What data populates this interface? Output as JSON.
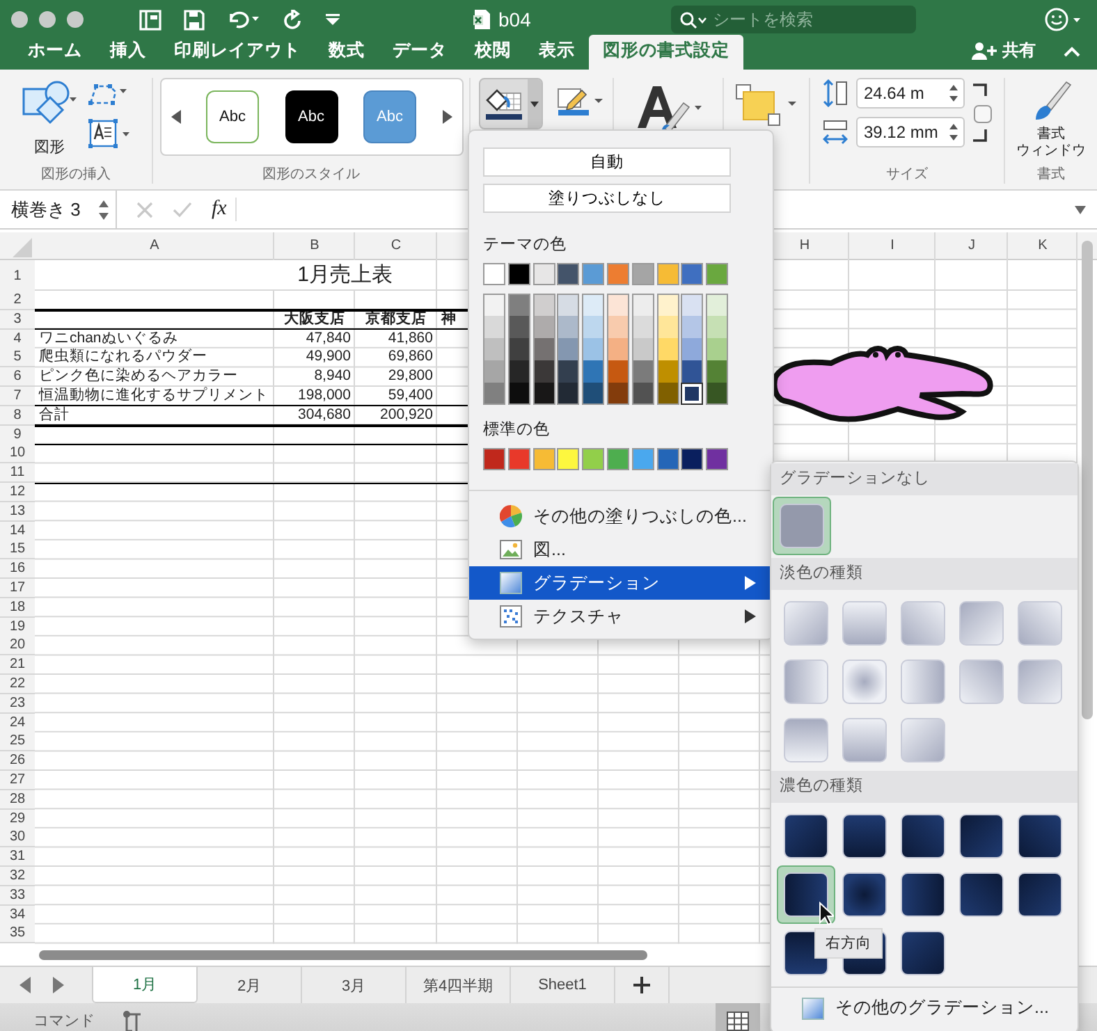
{
  "window": {
    "title": "b04",
    "search": {
      "placeholder": "シートを検索"
    }
  },
  "ribbon_tabs": [
    {
      "label": "ホーム",
      "selected": false
    },
    {
      "label": "挿入",
      "selected": false
    },
    {
      "label": "印刷レイアウト",
      "selected": false
    },
    {
      "label": "数式",
      "selected": false
    },
    {
      "label": "データ",
      "selected": false
    },
    {
      "label": "校閲",
      "selected": false
    },
    {
      "label": "表示",
      "selected": false
    },
    {
      "label": "図形の書式設定",
      "selected": true
    }
  ],
  "share": {
    "label": "共有"
  },
  "ribbon": {
    "insert_group": {
      "shape_label": "図形",
      "label": "図形の挿入"
    },
    "style_group": {
      "styles": [
        {
          "label": "Abc",
          "kind": "outline"
        },
        {
          "label": "Abc",
          "kind": "dark"
        },
        {
          "label": "Abc",
          "kind": "blue"
        }
      ],
      "label": "図形のスタイル"
    },
    "fill_button": {
      "open": true
    },
    "size_group": {
      "height": "24.64 m",
      "width": "39.12 mm",
      "label": "サイズ"
    },
    "format_group": {
      "button_lines": [
        "書式",
        "ウィンドウ"
      ],
      "label": "書式"
    }
  },
  "formula_bar": {
    "name_box": "横巻き 3",
    "fx": "fx"
  },
  "sheet": {
    "columns": [
      "A",
      "B",
      "C",
      "H",
      "I",
      "J",
      "K"
    ],
    "rows": [
      {
        "number": "1",
        "title": "1月売上表"
      },
      {
        "number": "2"
      },
      {
        "number": "3",
        "osaka": "大阪支店",
        "kyoto": "京都支店",
        "kobe": "神",
        "thick_line_above": true,
        "header": true
      },
      {
        "number": "4",
        "item": "ワニchanぬいぐるみ",
        "osaka": "47,840",
        "kyoto": "41,860",
        "thin_line_above": true
      },
      {
        "number": "5",
        "item": "爬虫類になれるパウダー",
        "osaka": "49,900",
        "kyoto": "69,860"
      },
      {
        "number": "6",
        "item": "ピンク色に染めるヘアカラー",
        "osaka": "8,940",
        "kyoto": "29,800"
      },
      {
        "number": "7",
        "item": "恒温動物に進化するサプリメント",
        "osaka": "198,000",
        "kyoto": "59,400"
      },
      {
        "number": "8",
        "item": "合計",
        "osaka": "304,680",
        "kyoto": "200,920",
        "thin_line_above": true,
        "thick_line_below": true
      },
      {
        "number": "9",
        "thin_line_below": true
      },
      {
        "number": "10"
      },
      {
        "number": "11",
        "thin_line_below": true
      },
      {
        "number": "12"
      },
      {
        "number": "13"
      },
      {
        "number": "14"
      },
      {
        "number": "15"
      },
      {
        "number": "16"
      },
      {
        "number": "17"
      },
      {
        "number": "18"
      },
      {
        "number": "19"
      },
      {
        "number": "20"
      },
      {
        "number": "21"
      },
      {
        "number": "22"
      },
      {
        "number": "23"
      },
      {
        "number": "24"
      },
      {
        "number": "25"
      },
      {
        "number": "26"
      },
      {
        "number": "27"
      },
      {
        "number": "28"
      },
      {
        "number": "29"
      },
      {
        "number": "30"
      },
      {
        "number": "31"
      },
      {
        "number": "32"
      },
      {
        "number": "33"
      },
      {
        "number": "34"
      },
      {
        "number": "35"
      }
    ]
  },
  "fill_menu": {
    "buttons": [
      "自動",
      "塗りつぶしなし"
    ],
    "theme_label": "テーマの色",
    "theme_colors": [
      {
        "color": "#ffffff",
        "selected": false
      },
      {
        "color": "#000000",
        "selected": false
      },
      {
        "color": "#e7e6e6",
        "selected": false
      },
      {
        "color": "#44546a",
        "selected": false
      },
      {
        "color": "#5b9bd5",
        "selected": false
      },
      {
        "color": "#ed7d31",
        "selected": false
      },
      {
        "color": "#a5a5a5",
        "selected": false
      },
      {
        "color": "#f6bb35",
        "selected": false
      },
      {
        "color": "#3f6fc0",
        "selected": false
      },
      {
        "color": "#6aa83f",
        "selected": false
      }
    ],
    "theme_shades": [
      [
        {
          "color": "#f2f2f2",
          "selected": false
        },
        {
          "color": "#d9d9d9",
          "selected": false
        },
        {
          "color": "#bfbfbf",
          "selected": false
        },
        {
          "color": "#a6a6a6",
          "selected": false
        },
        {
          "color": "#808080",
          "selected": false
        }
      ],
      [
        {
          "color": "#7f7f7f",
          "selected": false
        },
        {
          "color": "#595959",
          "selected": false
        },
        {
          "color": "#404040",
          "selected": false
        },
        {
          "color": "#262626",
          "selected": false
        },
        {
          "color": "#0d0d0d",
          "selected": false
        }
      ],
      [
        {
          "color": "#d0cece",
          "selected": false
        },
        {
          "color": "#aeabab",
          "selected": false
        },
        {
          "color": "#757171",
          "selected": false
        },
        {
          "color": "#3b3838",
          "selected": false
        },
        {
          "color": "#181717",
          "selected": false
        }
      ],
      [
        {
          "color": "#d6dce4",
          "selected": false
        },
        {
          "color": "#acb9ca",
          "selected": false
        },
        {
          "color": "#8497b0",
          "selected": false
        },
        {
          "color": "#333f4f",
          "selected": false
        },
        {
          "color": "#222a35",
          "selected": false
        }
      ],
      [
        {
          "color": "#ddebf7",
          "selected": false
        },
        {
          "color": "#bdd7ee",
          "selected": false
        },
        {
          "color": "#9bc2e6",
          "selected": false
        },
        {
          "color": "#2f75b5",
          "selected": false
        },
        {
          "color": "#1f4e78",
          "selected": false
        }
      ],
      [
        {
          "color": "#fce4d6",
          "selected": false
        },
        {
          "color": "#f8cbad",
          "selected": false
        },
        {
          "color": "#f4b084",
          "selected": false
        },
        {
          "color": "#c65911",
          "selected": false
        },
        {
          "color": "#833c0c",
          "selected": false
        }
      ],
      [
        {
          "color": "#ededed",
          "selected": false
        },
        {
          "color": "#dbdbdb",
          "selected": false
        },
        {
          "color": "#c9c9c9",
          "selected": false
        },
        {
          "color": "#7b7b7b",
          "selected": false
        },
        {
          "color": "#525252",
          "selected": false
        }
      ],
      [
        {
          "color": "#fff2cc",
          "selected": false
        },
        {
          "color": "#ffe699",
          "selected": false
        },
        {
          "color": "#ffd966",
          "selected": false
        },
        {
          "color": "#bf8f00",
          "selected": false
        },
        {
          "color": "#806000",
          "selected": false
        }
      ],
      [
        {
          "color": "#d9e1f2",
          "selected": false
        },
        {
          "color": "#b4c6e7",
          "selected": false
        },
        {
          "color": "#8ea9db",
          "selected": false
        },
        {
          "color": "#305496",
          "selected": false
        },
        {
          "color": "#203764",
          "selected": true
        }
      ],
      [
        {
          "color": "#e2efda",
          "selected": false
        },
        {
          "color": "#c6e0b4",
          "selected": false
        },
        {
          "color": "#a9d08e",
          "selected": false
        },
        {
          "color": "#548235",
          "selected": false
        },
        {
          "color": "#375623",
          "selected": false
        }
      ]
    ],
    "standard_label": "標準の色",
    "standard_colors": [
      {
        "color": "#c0281c",
        "selected": false
      },
      {
        "color": "#e8392a",
        "selected": false
      },
      {
        "color": "#f6bb35",
        "selected": false
      },
      {
        "color": "#fdf73f",
        "selected": false
      },
      {
        "color": "#92cf4a",
        "selected": false
      },
      {
        "color": "#4eae4f",
        "selected": false
      },
      {
        "color": "#4aa8ee",
        "selected": false
      },
      {
        "color": "#2466b7",
        "selected": false
      },
      {
        "color": "#0a1f5e",
        "selected": false
      },
      {
        "color": "#7030a0",
        "selected": false
      }
    ],
    "items": [
      {
        "label": "その他の塗りつぶしの色...",
        "kind": "palette",
        "selected": false,
        "submenu": false
      },
      {
        "label": "図...",
        "kind": "picture",
        "selected": false,
        "submenu": false
      },
      {
        "label": "グラデーション",
        "kind": "gradient",
        "selected": true,
        "submenu": true
      },
      {
        "label": "テクスチャ",
        "kind": "texture",
        "selected": false,
        "submenu": true
      }
    ]
  },
  "gradient_menu": {
    "sections": [
      {
        "title": "グラデーションなし",
        "kind": "none",
        "swatches": [
          {
            "selected": true
          }
        ]
      },
      {
        "title": "淡色の種類",
        "kind": "light",
        "swatches": [
          {
            "selected": false
          },
          {
            "selected": false
          },
          {
            "selected": false
          },
          {
            "selected": false
          },
          {
            "selected": false
          },
          {
            "selected": false
          },
          {
            "selected": false
          },
          {
            "selected": false
          },
          {
            "selected": false
          },
          {
            "selected": false
          },
          {
            "selected": false
          },
          {
            "selected": false
          },
          {
            "selected": false
          }
        ]
      },
      {
        "title": "濃色の種類",
        "kind": "dark",
        "swatches": [
          {
            "selected": false
          },
          {
            "selected": false
          },
          {
            "selected": false
          },
          {
            "selected": false
          },
          {
            "selected": false
          },
          {
            "selected": true
          },
          {
            "selected": false
          },
          {
            "selected": false
          },
          {
            "selected": false
          },
          {
            "selected": false
          },
          {
            "selected": false
          },
          {
            "selected": false
          },
          {
            "selected": false
          }
        ]
      }
    ],
    "footer": "その他のグラデーション..."
  },
  "tooltip": "右方向",
  "sheet_tabs": [
    {
      "label": "1月",
      "selected": true
    },
    {
      "label": "2月",
      "selected": false
    },
    {
      "label": "3月",
      "selected": false
    },
    {
      "label": "第4四半期",
      "selected": false
    },
    {
      "label": "Sheet1",
      "selected": false
    }
  ],
  "status_bar": {
    "mode": "コマンド"
  }
}
